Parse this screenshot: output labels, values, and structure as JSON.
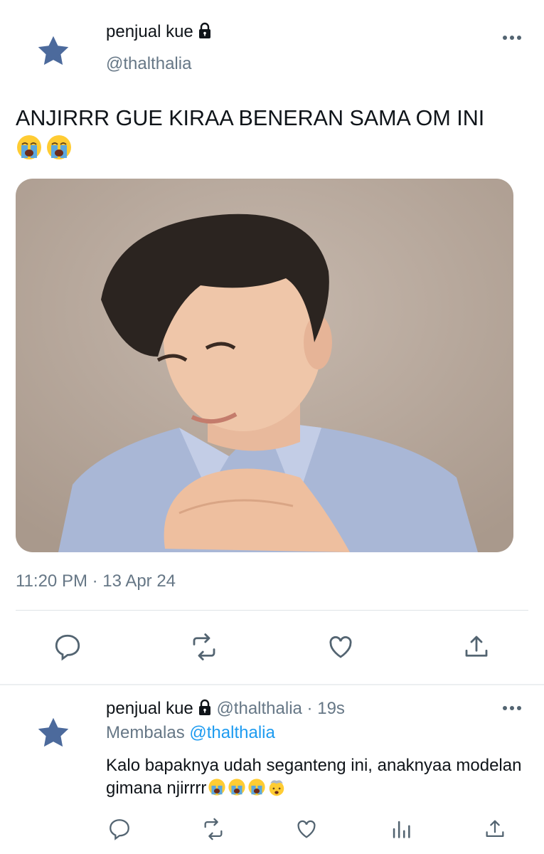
{
  "main_tweet": {
    "display_name": "penjual kue",
    "handle": "@thalthalia",
    "text_line1": "ANJIRRR GUE KIRAA BENERAN SAMA OM INI",
    "text_emojis": "😭😭",
    "timestamp": "11:20 PM · 13 Apr 24",
    "media_description": "photo of a man in a light blue shirt resting his chin on clasped hands",
    "actions": [
      "reply-icon",
      "retweet-icon",
      "like-icon",
      "share-icon"
    ]
  },
  "reply_tweet": {
    "display_name": "penjual kue",
    "handle": "@thalthalia",
    "separator": "·",
    "time_ago": "19s",
    "replying_label": "Membalas",
    "replying_to": "@thalthalia",
    "text": "Kalo bapaknya udah seganteng ini, anaknyaa modelan gimana njirrrr",
    "text_emojis": "😭😭😭🤯",
    "actions": [
      "reply-icon",
      "retweet-icon",
      "like-icon",
      "views-icon",
      "share-icon"
    ]
  },
  "colors": {
    "avatar_star": "#4c6a9c",
    "muted_text": "#667786",
    "mention_blue": "#1d9bf0"
  }
}
